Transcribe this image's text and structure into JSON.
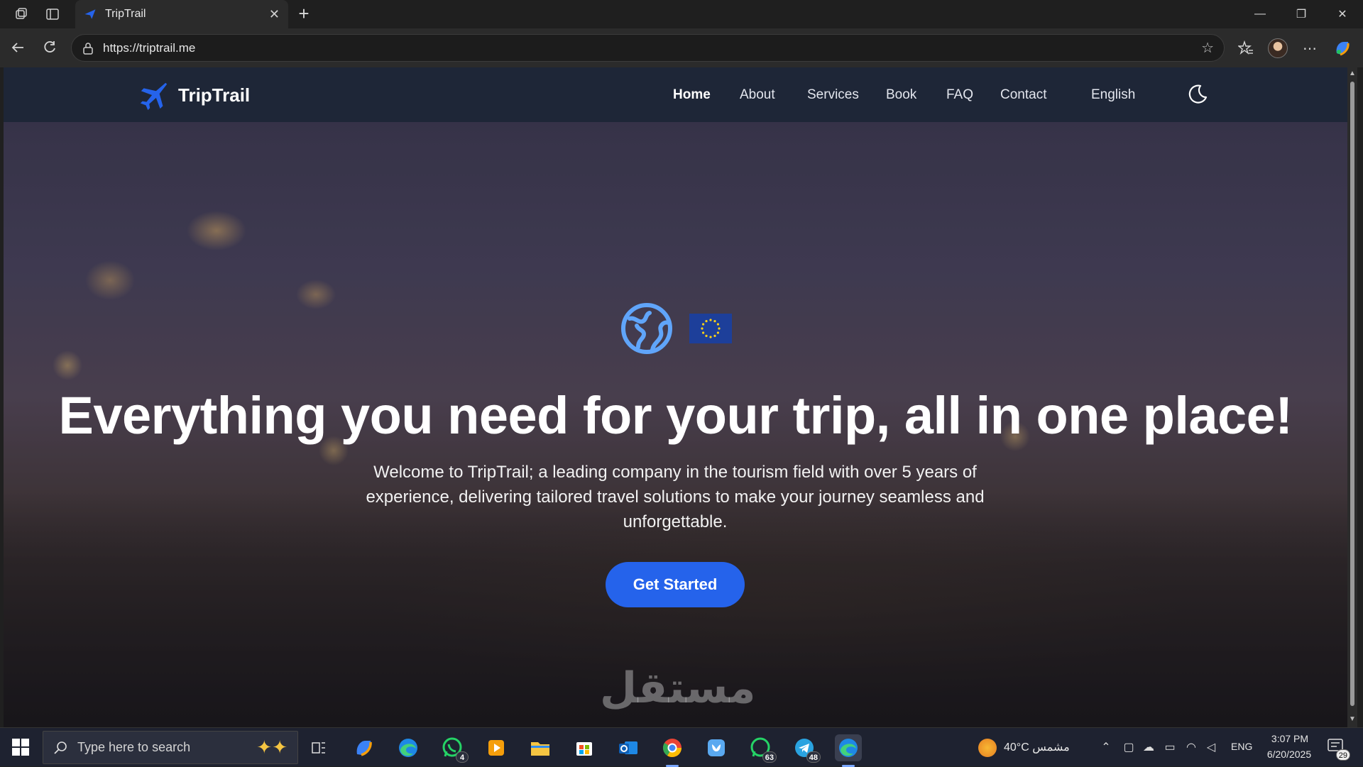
{
  "browser": {
    "tab_title": "TripTrail",
    "tab_close": "✕",
    "new_tab": "+",
    "url": "https://triptrail.me",
    "window_controls": {
      "minimize": "—",
      "restore": "❐",
      "close": "✕"
    }
  },
  "site": {
    "brand": "TripTrail",
    "nav": [
      {
        "label": "Home",
        "active": true
      },
      {
        "label": "About"
      },
      {
        "label": "Services"
      },
      {
        "label": "Book"
      },
      {
        "label": "FAQ"
      },
      {
        "label": "Contact"
      }
    ],
    "language": "English",
    "theme_toggle_icon": "moon-icon",
    "hero": {
      "headline": "Everything you need for your trip, all in one place!",
      "subtitle": "Welcome to TripTrail; a leading company in the tourism field with over 5 years of experience, delivering tailored travel solutions to make your journey seamless and unforgettable.",
      "cta": "Get Started"
    },
    "watermark": "مستقل"
  },
  "taskbar": {
    "search_placeholder": "Type here to search",
    "badges": {
      "whatsapp": "4",
      "whatsapp2": "63",
      "telegram": "48"
    },
    "weather": "40°C مشمس",
    "language": "ENG",
    "time": "3:07 PM",
    "date": "6/20/2025",
    "notifications": "29"
  },
  "colors": {
    "nav_bg": "#1e2637",
    "accent": "#2563eb",
    "brand_icon": "#2563eb"
  }
}
